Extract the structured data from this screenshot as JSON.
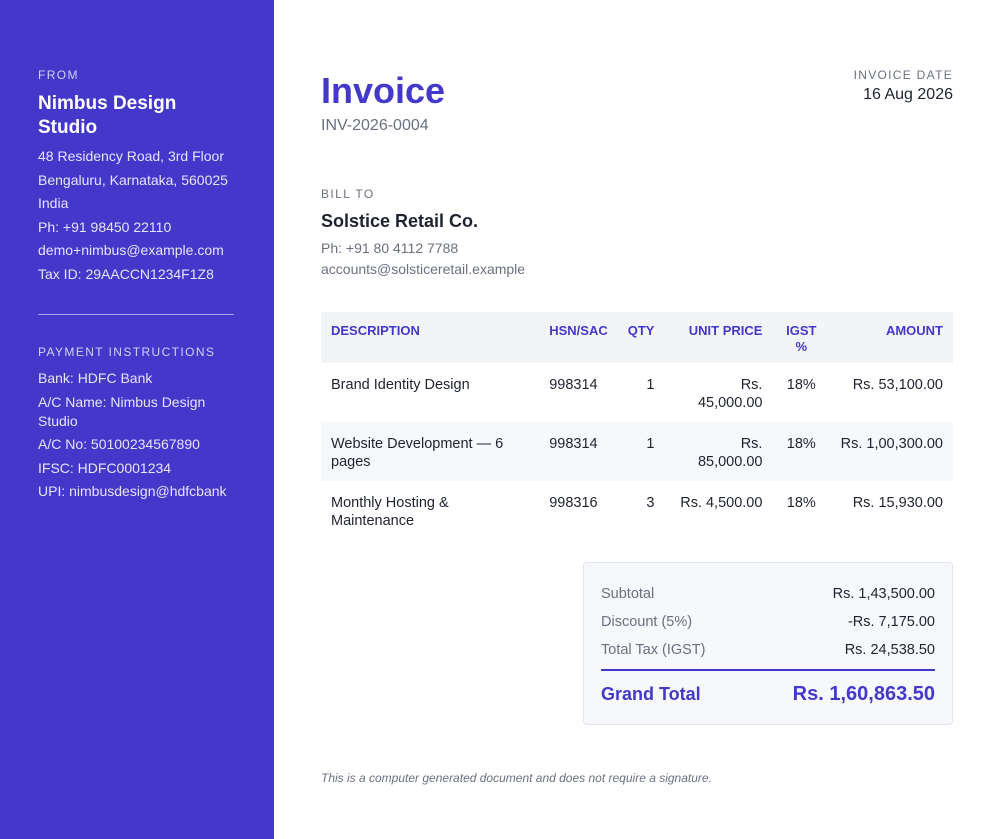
{
  "sender": {
    "label": "FROM",
    "name": "Nimbus Design Studio",
    "lines": [
      "48 Residency Road, 3rd Floor",
      "Bengaluru, Karnataka, 560025",
      "India",
      "Ph: +91 98450 22110",
      "demo+nimbus@example.com",
      "Tax ID: 29AACCN1234F1Z8"
    ]
  },
  "payment": {
    "label": "PAYMENT INSTRUCTIONS",
    "lines": [
      "Bank: HDFC Bank",
      "A/C Name: Nimbus Design Studio",
      "A/C No: 50100234567890",
      "IFSC: HDFC0001234",
      "UPI: nimbusdesign@hdfcbank"
    ]
  },
  "invoice": {
    "title": "Invoice",
    "number": "INV-2026-0004",
    "date_label": "INVOICE DATE",
    "date": "16 Aug 2026"
  },
  "bill_to": {
    "label": "BILL TO",
    "name": "Solstice Retail Co.",
    "phone": "Ph: +91 80 4112 7788",
    "email": "accounts@solsticeretail.example"
  },
  "table": {
    "headers": {
      "description": "DESCRIPTION",
      "hsn": "HSN/SAC",
      "qty": "QTY",
      "unit_price": "UNIT PRICE",
      "igst": "IGST %",
      "amount": "AMOUNT"
    },
    "rows": [
      {
        "description": "Brand Identity Design",
        "hsn": "998314",
        "qty": "1",
        "unit_price": "Rs. 45,000.00",
        "igst": "18%",
        "amount": "Rs. 53,100.00"
      },
      {
        "description": "Website Development — 6 pages",
        "hsn": "998314",
        "qty": "1",
        "unit_price": "Rs. 85,000.00",
        "igst": "18%",
        "amount": "Rs. 1,00,300.00"
      },
      {
        "description": "Monthly Hosting & Maintenance",
        "hsn": "998316",
        "qty": "3",
        "unit_price": "Rs. 4,500.00",
        "igst": "18%",
        "amount": "Rs. 15,930.00"
      }
    ]
  },
  "totals": {
    "subtotal_label": "Subtotal",
    "subtotal": "Rs. 1,43,500.00",
    "discount_label": "Discount (5%)",
    "discount": "-Rs. 7,175.00",
    "tax_label": "Total Tax (IGST)",
    "tax": "Rs. 24,538.50",
    "grand_label": "Grand Total",
    "grand": "Rs. 1,60,863.50"
  },
  "footer": {
    "note": "This is a computer generated document and does not require a signature."
  },
  "colors": {
    "accent": "#4338ca",
    "muted_text": "#6b7080",
    "table_header_bg": "#f3f4f8"
  }
}
